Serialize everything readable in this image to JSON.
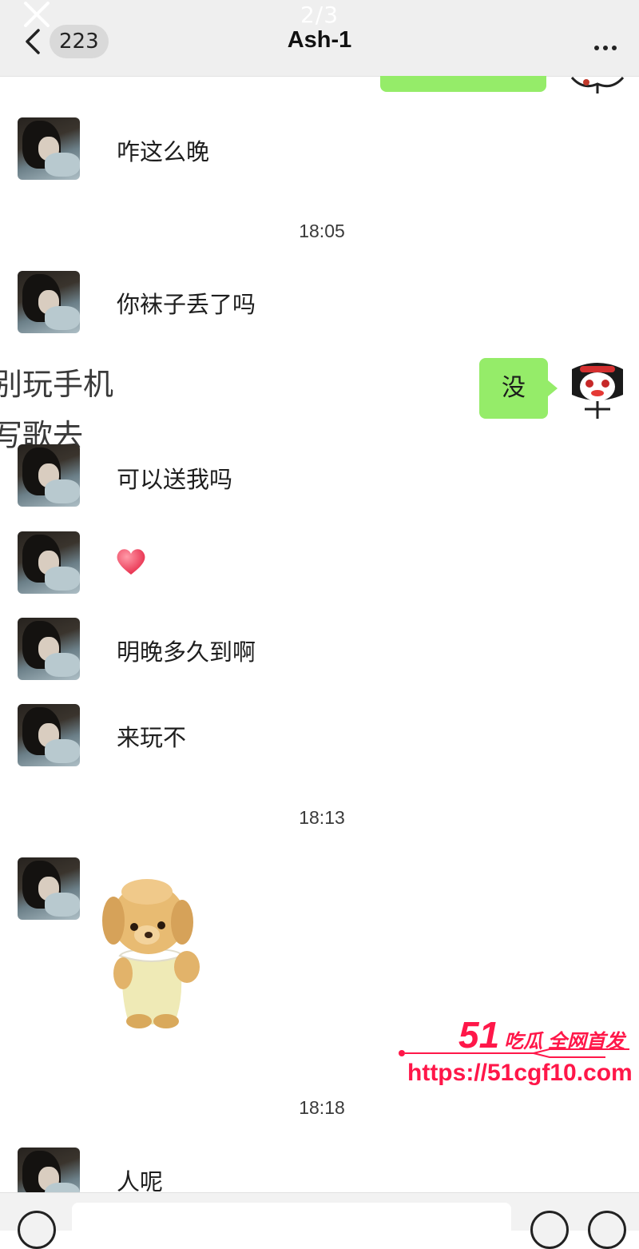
{
  "viewer": {
    "counter": "2/3",
    "close_icon": "close-icon"
  },
  "header": {
    "back_icon": "chevron-left-icon",
    "unread_count": "223",
    "title": "Ash-1",
    "more_icon": "more-dots-icon"
  },
  "messages": [
    {
      "text": "咋这么晚"
    },
    {
      "time": "18:05"
    },
    {
      "text": "你袜子丢了吗"
    },
    {
      "out_text": "没"
    },
    {
      "text": "可以送我吗"
    },
    {
      "sticker": "heart-emoji"
    },
    {
      "text": "明晚多久到啊"
    },
    {
      "text": "来玩不"
    },
    {
      "time": "18:13"
    },
    {
      "sticker": "plush-puppy-sticker"
    },
    {
      "time": "18:18"
    },
    {
      "text": "人呢"
    }
  ],
  "overlay_caption": {
    "line1": "别玩手机",
    "line2": "写歌去"
  },
  "watermark": {
    "logo_num": "51",
    "logo_tag": "吃瓜 全网首发",
    "url": "https://51cgf10.com",
    "color": "#ff1749"
  },
  "bottom_bar": {
    "voice_icon": "voice-icon",
    "emoji_icon": "emoji-icon",
    "plus_icon": "plus-icon"
  },
  "colors": {
    "out_bubble": "#95ec69",
    "header_bg": "#efefef"
  }
}
